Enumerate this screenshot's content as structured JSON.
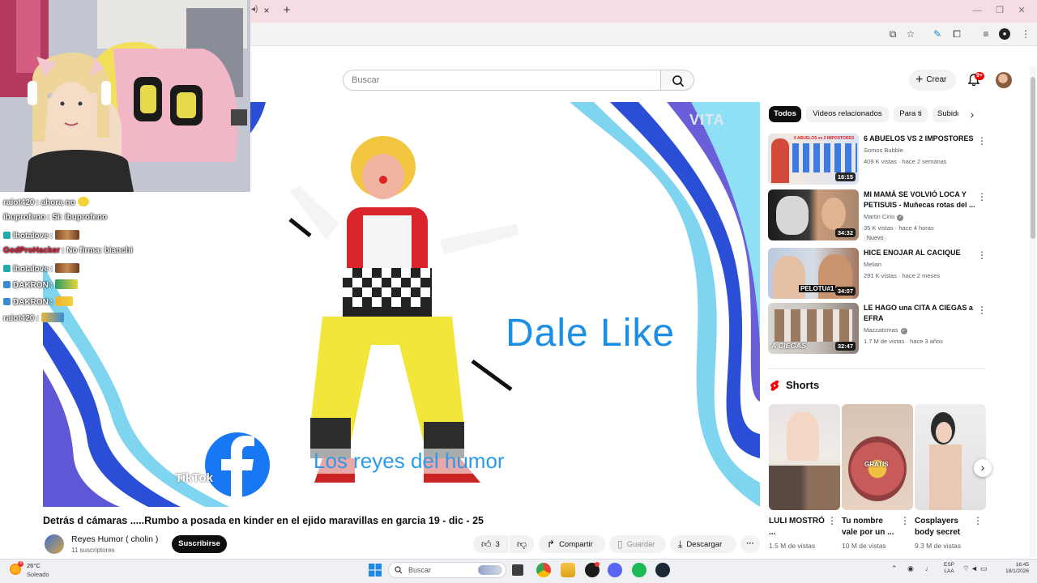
{
  "browser": {
    "tab_close": "×",
    "tab_new": "+",
    "window_controls": [
      "—",
      "❐",
      "✕"
    ],
    "toolbar_icons": [
      "install-icon",
      "star-icon",
      "extension-icon",
      "puzzle-icon",
      "media-icon",
      "profile-icon",
      "kebab-icon"
    ]
  },
  "youtube_header": {
    "search_placeholder": "Buscar",
    "create_label": "Crear",
    "notification_badge": "9+"
  },
  "chat": [
    {
      "user": "raiot420",
      "message": ": ahora no",
      "user_color": "#ffffff",
      "has_emote": true
    },
    {
      "user": "ibuprofeno",
      "message": ": Si: ibuprofeno",
      "user_color": "#ffffff",
      "has_emote": false
    },
    {
      "user": "lhotalove",
      "message": ":",
      "user_color": "#ffffff",
      "has_emote": true
    },
    {
      "user": "GodProHacker",
      "message": ": No firma: bianchi",
      "user_color": "#e21b3c",
      "has_emote": false
    },
    {
      "user": "lhotalove",
      "message": ":",
      "user_color": "#ffffff",
      "has_emote": true
    },
    {
      "user": "DAKRON",
      "message": ":",
      "user_color": "#ffffff",
      "has_emote": true
    },
    {
      "user": "DAKRON",
      "message": ":",
      "user_color": "#ffffff",
      "has_emote": true
    },
    {
      "user": "raiot420",
      "message": ":",
      "user_color": "#ffffff",
      "has_emote": true
    }
  ],
  "video": {
    "overlay_text_main": "Dale Like",
    "overlay_text_sub": "Los reyes del humor",
    "watermark": "VITA",
    "tiktok_text": "TikTok",
    "title": "Detrás d cámaras .....Rumbo a posada en kinder en el ejido maravillas en garcia 19 - dic - 25",
    "channel_name": "Reyes Humor ( cholin )",
    "channel_subs": "11 suscriptores",
    "subscribe_label": "Suscribirse",
    "like_count": "3",
    "share_label": "Compartir",
    "save_label": "Guardar",
    "download_label": "Descargar",
    "more_label": "···"
  },
  "chips": [
    "Todos",
    "Videos relacionados",
    "Para ti",
    "Subidos"
  ],
  "recommendations": [
    {
      "title": "6 ABUELOS VS 2 IMPOSTORES",
      "channel": "Somos Bubble",
      "verified": false,
      "meta": "409 K vistas · hace 2 semanas",
      "duration": "16:15",
      "badge": "",
      "thumb_text": "6 ABUELOS vs 2 IMPOSTORES"
    },
    {
      "title": "MI MAMÁ SE VOLVIÓ LOCA Y PETISUIS - Muñecas rotas del ...",
      "channel": "Martin Cirio",
      "verified": true,
      "meta": "35 K vistas · hace 4 horas",
      "duration": "34:32",
      "badge": "Nuevo",
      "thumb_text": ""
    },
    {
      "title": "HICE ENOJAR AL CACIQUE",
      "channel": "Melian",
      "verified": false,
      "meta": "291 K vistas · hace 2 meses",
      "duration": "34:07",
      "badge": "",
      "thumb_text": "PELOTU#1"
    },
    {
      "title": "LE HAGO una CITA A CIEGAS a EFRA",
      "channel": "Mazzatomas",
      "verified": true,
      "meta": "1.7 M de vistas · hace 3 años",
      "duration": "32:47",
      "badge": "",
      "thumb_text": "A CIEGAS"
    }
  ],
  "shorts": {
    "heading": "Shorts",
    "items": [
      {
        "title": "LULI MOSTRÓ ...",
        "views": "1.5 M de vistas",
        "thumb_text": ""
      },
      {
        "title": "Tu nombre vale por un ...",
        "views": "10 M de vistas",
        "thumb_text": "GRATIS"
      },
      {
        "title": "Cosplayers body secret",
        "views": "9.3 M de vistas",
        "thumb_text": ""
      }
    ]
  },
  "taskbar": {
    "temperature": "26°C",
    "weather": "Soleado",
    "search_label": "Buscar",
    "lang_top": "ESP",
    "lang_bottom": "LAA",
    "time": "16:45",
    "date": "18/1/2026"
  }
}
